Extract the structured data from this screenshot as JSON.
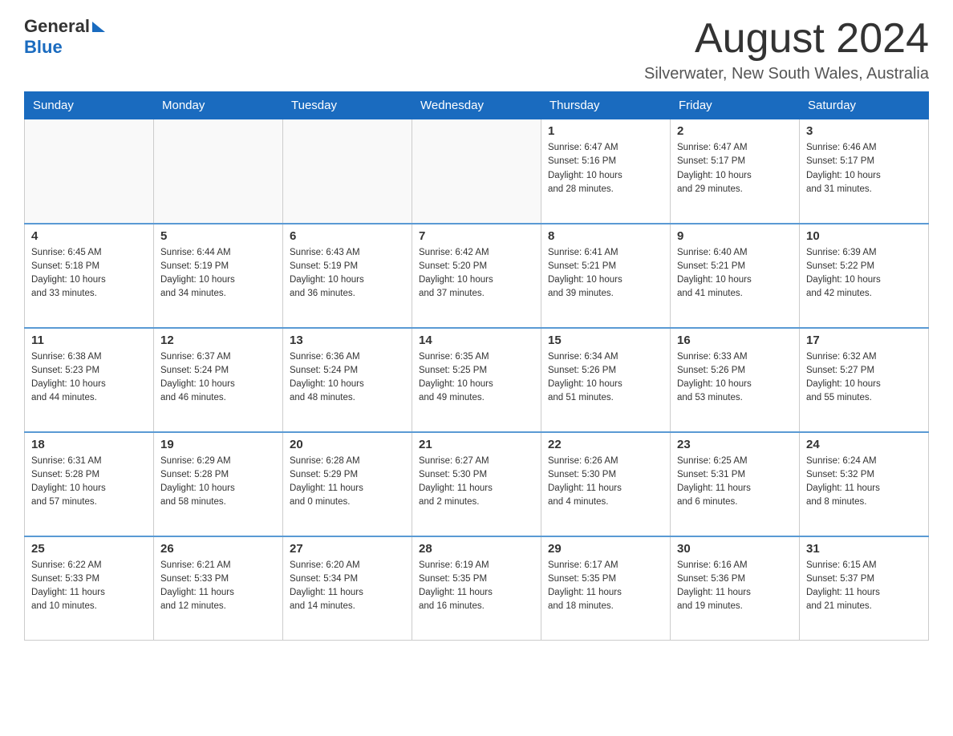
{
  "logo": {
    "general": "General",
    "blue": "Blue"
  },
  "header": {
    "month": "August 2024",
    "location": "Silverwater, New South Wales, Australia"
  },
  "weekdays": [
    "Sunday",
    "Monday",
    "Tuesday",
    "Wednesday",
    "Thursday",
    "Friday",
    "Saturday"
  ],
  "weeks": [
    [
      {
        "day": "",
        "info": ""
      },
      {
        "day": "",
        "info": ""
      },
      {
        "day": "",
        "info": ""
      },
      {
        "day": "",
        "info": ""
      },
      {
        "day": "1",
        "info": "Sunrise: 6:47 AM\nSunset: 5:16 PM\nDaylight: 10 hours\nand 28 minutes."
      },
      {
        "day": "2",
        "info": "Sunrise: 6:47 AM\nSunset: 5:17 PM\nDaylight: 10 hours\nand 29 minutes."
      },
      {
        "day": "3",
        "info": "Sunrise: 6:46 AM\nSunset: 5:17 PM\nDaylight: 10 hours\nand 31 minutes."
      }
    ],
    [
      {
        "day": "4",
        "info": "Sunrise: 6:45 AM\nSunset: 5:18 PM\nDaylight: 10 hours\nand 33 minutes."
      },
      {
        "day": "5",
        "info": "Sunrise: 6:44 AM\nSunset: 5:19 PM\nDaylight: 10 hours\nand 34 minutes."
      },
      {
        "day": "6",
        "info": "Sunrise: 6:43 AM\nSunset: 5:19 PM\nDaylight: 10 hours\nand 36 minutes."
      },
      {
        "day": "7",
        "info": "Sunrise: 6:42 AM\nSunset: 5:20 PM\nDaylight: 10 hours\nand 37 minutes."
      },
      {
        "day": "8",
        "info": "Sunrise: 6:41 AM\nSunset: 5:21 PM\nDaylight: 10 hours\nand 39 minutes."
      },
      {
        "day": "9",
        "info": "Sunrise: 6:40 AM\nSunset: 5:21 PM\nDaylight: 10 hours\nand 41 minutes."
      },
      {
        "day": "10",
        "info": "Sunrise: 6:39 AM\nSunset: 5:22 PM\nDaylight: 10 hours\nand 42 minutes."
      }
    ],
    [
      {
        "day": "11",
        "info": "Sunrise: 6:38 AM\nSunset: 5:23 PM\nDaylight: 10 hours\nand 44 minutes."
      },
      {
        "day": "12",
        "info": "Sunrise: 6:37 AM\nSunset: 5:24 PM\nDaylight: 10 hours\nand 46 minutes."
      },
      {
        "day": "13",
        "info": "Sunrise: 6:36 AM\nSunset: 5:24 PM\nDaylight: 10 hours\nand 48 minutes."
      },
      {
        "day": "14",
        "info": "Sunrise: 6:35 AM\nSunset: 5:25 PM\nDaylight: 10 hours\nand 49 minutes."
      },
      {
        "day": "15",
        "info": "Sunrise: 6:34 AM\nSunset: 5:26 PM\nDaylight: 10 hours\nand 51 minutes."
      },
      {
        "day": "16",
        "info": "Sunrise: 6:33 AM\nSunset: 5:26 PM\nDaylight: 10 hours\nand 53 minutes."
      },
      {
        "day": "17",
        "info": "Sunrise: 6:32 AM\nSunset: 5:27 PM\nDaylight: 10 hours\nand 55 minutes."
      }
    ],
    [
      {
        "day": "18",
        "info": "Sunrise: 6:31 AM\nSunset: 5:28 PM\nDaylight: 10 hours\nand 57 minutes."
      },
      {
        "day": "19",
        "info": "Sunrise: 6:29 AM\nSunset: 5:28 PM\nDaylight: 10 hours\nand 58 minutes."
      },
      {
        "day": "20",
        "info": "Sunrise: 6:28 AM\nSunset: 5:29 PM\nDaylight: 11 hours\nand 0 minutes."
      },
      {
        "day": "21",
        "info": "Sunrise: 6:27 AM\nSunset: 5:30 PM\nDaylight: 11 hours\nand 2 minutes."
      },
      {
        "day": "22",
        "info": "Sunrise: 6:26 AM\nSunset: 5:30 PM\nDaylight: 11 hours\nand 4 minutes."
      },
      {
        "day": "23",
        "info": "Sunrise: 6:25 AM\nSunset: 5:31 PM\nDaylight: 11 hours\nand 6 minutes."
      },
      {
        "day": "24",
        "info": "Sunrise: 6:24 AM\nSunset: 5:32 PM\nDaylight: 11 hours\nand 8 minutes."
      }
    ],
    [
      {
        "day": "25",
        "info": "Sunrise: 6:22 AM\nSunset: 5:33 PM\nDaylight: 11 hours\nand 10 minutes."
      },
      {
        "day": "26",
        "info": "Sunrise: 6:21 AM\nSunset: 5:33 PM\nDaylight: 11 hours\nand 12 minutes."
      },
      {
        "day": "27",
        "info": "Sunrise: 6:20 AM\nSunset: 5:34 PM\nDaylight: 11 hours\nand 14 minutes."
      },
      {
        "day": "28",
        "info": "Sunrise: 6:19 AM\nSunset: 5:35 PM\nDaylight: 11 hours\nand 16 minutes."
      },
      {
        "day": "29",
        "info": "Sunrise: 6:17 AM\nSunset: 5:35 PM\nDaylight: 11 hours\nand 18 minutes."
      },
      {
        "day": "30",
        "info": "Sunrise: 6:16 AM\nSunset: 5:36 PM\nDaylight: 11 hours\nand 19 minutes."
      },
      {
        "day": "31",
        "info": "Sunrise: 6:15 AM\nSunset: 5:37 PM\nDaylight: 11 hours\nand 21 minutes."
      }
    ]
  ]
}
